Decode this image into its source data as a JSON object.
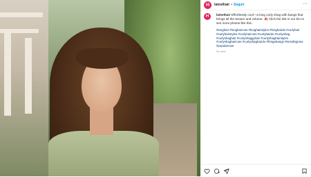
{
  "post": {
    "avatar_letter": "H",
    "username": "latesthair",
    "separator": "•",
    "follow_label": "Seguir",
    "more_label": "···"
  },
  "caption": {
    "username": "latesthair",
    "text": "Effortlessly cool—a long curly shag with bangs that brings all the texture and volume. 🍂 Click the link in our bio to see more photos like this.",
    "hashtags": "#longhair #longhaircuts #longhairstyles #longhairdo #curlyhair #curlyhairstyles #curlyhaircuts #curlyhairdo #curlyshag #curlyshaghair #curlyshaggyhair #curlyshaghairstyles #curlyshaghaircuts #curlyshaghairdo #fringebangs #trendingnow #popularnow",
    "age": "51 sem."
  },
  "actions": {
    "like": "heart-icon",
    "comment": "comment-icon",
    "share": "share-icon",
    "save": "bookmark-icon"
  },
  "colors": {
    "brand": "#e4245a",
    "link": "#0095f6",
    "hashtag": "#00376b"
  }
}
